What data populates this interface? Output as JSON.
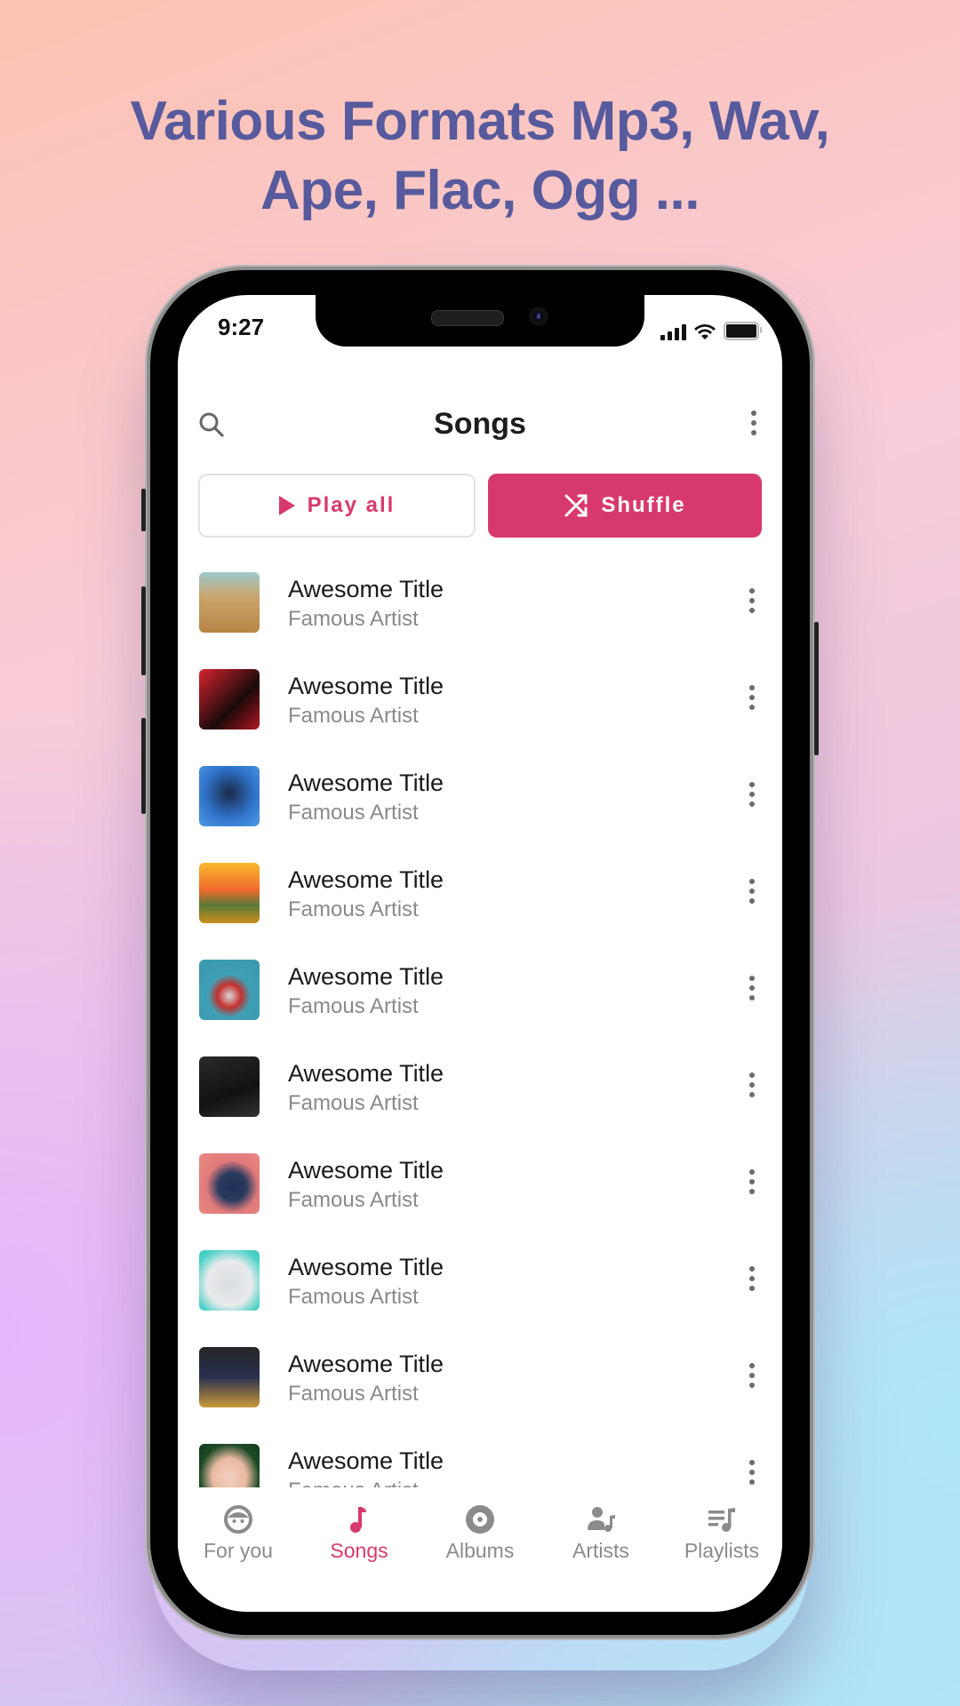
{
  "headline": {
    "line1": "Various Formats Mp3, Wav,",
    "line2": "Ape, Flac, Ogg ..."
  },
  "status_bar": {
    "time": "9:27",
    "icons": [
      "signal-icon",
      "wifi-icon",
      "battery-icon"
    ]
  },
  "header": {
    "title": "Songs",
    "search_icon": "search-icon",
    "more_icon": "more-vertical-icon"
  },
  "actions": {
    "play_all_label": "Play all",
    "shuffle_label": "Shuffle"
  },
  "colors": {
    "accent": "#d8396c",
    "headline": "#575a9c",
    "title_text": "#1a1a1a",
    "subtitle_text": "#8a8a8a",
    "nav_inactive": "#8b8b8b"
  },
  "songs": [
    {
      "title": "Awesome Title",
      "artist": "Famous Artist",
      "art": "art-field"
    },
    {
      "title": "Awesome Title",
      "artist": "Famous Artist",
      "art": "art-red"
    },
    {
      "title": "Awesome Title",
      "artist": "Famous Artist",
      "art": "art-blue"
    },
    {
      "title": "Awesome Title",
      "artist": "Famous Artist",
      "art": "art-sunset"
    },
    {
      "title": "Awesome Title",
      "artist": "Famous Artist",
      "art": "art-teal"
    },
    {
      "title": "Awesome Title",
      "artist": "Famous Artist",
      "art": "art-love"
    },
    {
      "title": "Awesome Title",
      "artist": "Famous Artist",
      "art": "art-pink"
    },
    {
      "title": "Awesome Title",
      "artist": "Famous Artist",
      "art": "art-aqua"
    },
    {
      "title": "Awesome Title",
      "artist": "Famous Artist",
      "art": "art-dark"
    },
    {
      "title": "Awesome Title",
      "artist": "Famous Artist",
      "art": "art-green"
    }
  ],
  "bottom_nav": [
    {
      "label": "For you",
      "icon": "face-icon",
      "active": false
    },
    {
      "label": "Songs",
      "icon": "music-note-icon",
      "active": true
    },
    {
      "label": "Albums",
      "icon": "disc-icon",
      "active": false
    },
    {
      "label": "Artists",
      "icon": "artist-icon",
      "active": false
    },
    {
      "label": "Playlists",
      "icon": "playlist-icon",
      "active": false
    }
  ]
}
